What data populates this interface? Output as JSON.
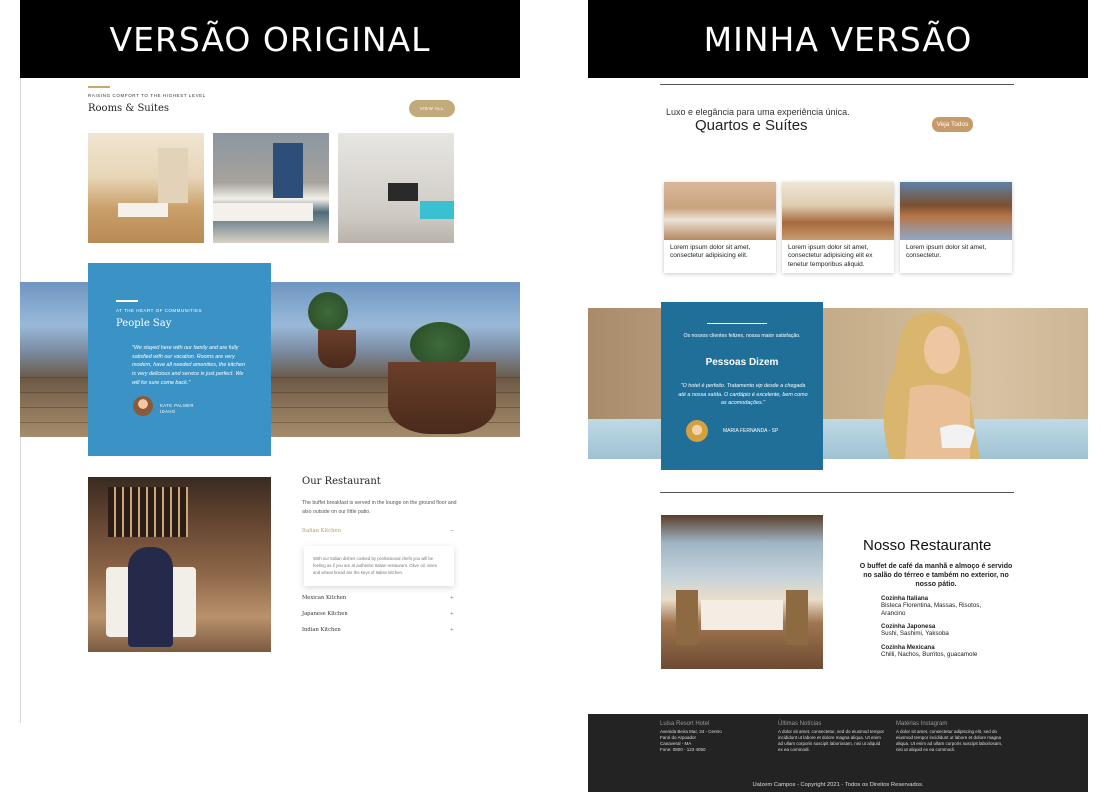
{
  "banners": {
    "left": "VERSÃO ORIGINAL",
    "right": "MINHA VERSÃO"
  },
  "original": {
    "rooms": {
      "eyebrow": "RAISING COMFORT TO THE HIGHEST LEVEL",
      "title": "Rooms & Suites",
      "button": "VIEW ALL"
    },
    "testimonial": {
      "eyebrow": "AT THE HEART OF COMMUNITIES",
      "title": "People Say",
      "quote": "\"We stayed here with our family and are fully satisfied with our vacation. Rooms are very modern, have all needed amenities, the kitchen is very delicious and service is just perfect. We will for sure come back.\"",
      "name": "KATE PALMER",
      "location": "IDAHO"
    },
    "restaurant": {
      "title": "Our Restaurant",
      "description": "The buffet breakfast is served in the lounge on the ground floor and also outside on our little patio.",
      "items": [
        {
          "label": "Italian Kitchen",
          "symbol": "−"
        },
        {
          "label": "Mexican Kitchen",
          "symbol": "+"
        },
        {
          "label": "Japanese Kitchen",
          "symbol": "+"
        },
        {
          "label": "Indian Kitchen",
          "symbol": "+"
        }
      ],
      "panel_text": "With our Italian dishes cooked by professional chefs you will be feeling as if you are at authentic Italian restaurant. Olive oil, vines and wheat bread are the keys of Italian kitchen."
    }
  },
  "mine": {
    "rooms": {
      "tagline": "Luxo e elegância para uma experiência única.",
      "title": "Quartos e Suítes",
      "button": "Veja Todos",
      "cards": [
        {
          "text": "Lorem ipsum dolor sit amet, consectetur adipisicing elit."
        },
        {
          "text": "Lorem ipsum dolor sit amet, consectetur adipisicing elit ex tenetur temporibus aliquid."
        },
        {
          "text": "Lorem ipsum dolor sit amet, consectetur."
        }
      ]
    },
    "testimonial": {
      "eyebrow": "Os nossos clientes felizes, nossa maior satisfação.",
      "title": "Pessoas Dizem",
      "quote": "\"O hotel é perfeito. Tratamento vip desde a chegada até a nossa saída. O cardápio é excelente, bem como as acomodações.\"",
      "name": "MARIA FERNANDA - SP"
    },
    "restaurant": {
      "title": "Nosso Restaurante",
      "description": "O buffet de café da manhã e almoço é servido no salão do térreo e também no exterior, no nosso pátio.",
      "cuisines": [
        {
          "name": "Cozinha Italiana",
          "dishes": "Bisteca Florentina, Massas, Risotos, Arancino"
        },
        {
          "name": "Cozinha Japonesa",
          "dishes": "Sushi, Sashimi, Yaksoba"
        },
        {
          "name": "Cozinha Mexicana",
          "dishes": "Chilli, Nachos, Burritos, guacamole"
        }
      ]
    },
    "footer": {
      "col1": {
        "heading": "Luisa Resort Hotel",
        "lines": [
          "Avenida Beira Mar, 34 - Centro",
          "Farol do Arpoador",
          "Canaveral - MA",
          "Fone: 0800 - 123 4050"
        ]
      },
      "col2": {
        "heading": "Últimas Notícias",
        "text": "A dolor sit amet, consectetur, sed do eiusmod tempor incididunt ut labore et dolore magna aliqua. Ut enim ad ullam corporis suscipit laboriosam, nisi ut aliquid ex ea commodi."
      },
      "col3": {
        "heading": "Matérias Instagram",
        "text": "A dolor sit amet, consectetur adipiscing elit, sed do eiusmod tempor incididunt ut labore et dolore magna aliqua. Ut enim ad ullam corporis suscipit laboriosam, nisi ut aliquid ex ea commodi."
      },
      "copyright": "Ualzem Campos - Copyright 2021 - Todos os Direitos Reservados."
    }
  },
  "colors": {
    "gold": "#c6a96b",
    "blue_original": "#3a93c4",
    "blue_mine": "#1f6f99",
    "footer_bg": "#232323"
  }
}
